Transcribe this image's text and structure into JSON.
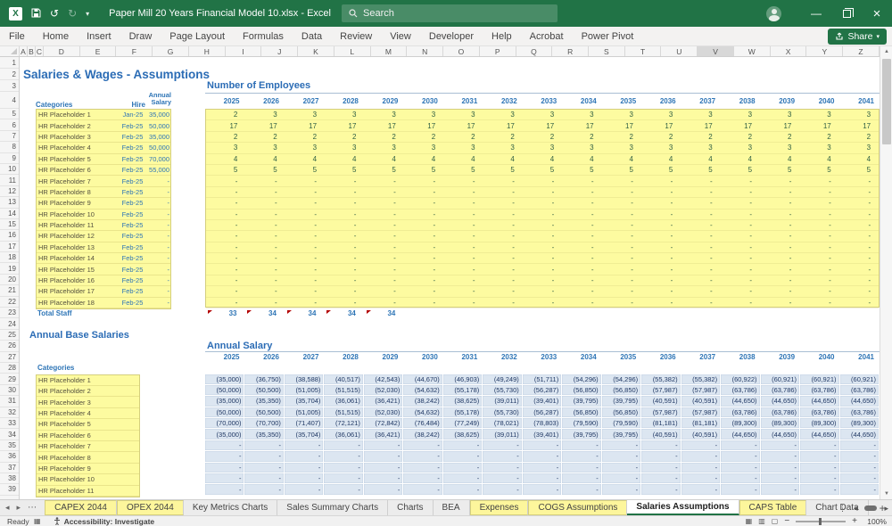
{
  "titlebar": {
    "title": "Paper Mill 20 Years Financial Model 10.xlsx  -  Excel",
    "search_placeholder": "Search"
  },
  "ribbon": {
    "tabs": [
      "File",
      "Home",
      "Insert",
      "Draw",
      "Page Layout",
      "Formulas",
      "Data",
      "Review",
      "View",
      "Developer",
      "Help",
      "Acrobat",
      "Power Pivot"
    ],
    "share_label": "Share"
  },
  "colgrid": {
    "narrow_letters": [
      "A",
      "B",
      "C"
    ],
    "wide_letters": [
      "D",
      "E",
      "F",
      "G",
      "H",
      "I",
      "J",
      "K",
      "L",
      "M",
      "N",
      "O",
      "P",
      "Q",
      "R",
      "S",
      "T",
      "U",
      "V",
      "W",
      "X",
      "Y",
      "Z"
    ],
    "selected_letter": "V",
    "first_row": 1,
    "last_row": 39
  },
  "sheet": {
    "page_title": "Salaries & Wages - Assumptions",
    "hire_table": {
      "headers": {
        "categories": "Categories",
        "hire": "Hire",
        "salary": "Annual Salary"
      },
      "rows": [
        {
          "category": "HR Placeholder 1",
          "hire": "Jan-25",
          "salary": "35,000"
        },
        {
          "category": "HR Placeholder 2",
          "hire": "Feb-25",
          "salary": "50,000"
        },
        {
          "category": "HR Placeholder 3",
          "hire": "Feb-25",
          "salary": "35,000"
        },
        {
          "category": "HR Placeholder 4",
          "hire": "Feb-25",
          "salary": "50,000"
        },
        {
          "category": "HR Placeholder 5",
          "hire": "Feb-25",
          "salary": "70,000"
        },
        {
          "category": "HR Placeholder 6",
          "hire": "Feb-25",
          "salary": "55,000"
        },
        {
          "category": "HR Placeholder 7",
          "hire": "Feb-25",
          "salary": "-"
        },
        {
          "category": "HR Placeholder 8",
          "hire": "Feb-25",
          "salary": "-"
        },
        {
          "category": "HR Placeholder 9",
          "hire": "Feb-25",
          "salary": "-"
        },
        {
          "category": "HR Placeholder 10",
          "hire": "Feb-25",
          "salary": "-"
        },
        {
          "category": "HR Placeholder 11",
          "hire": "Feb-25",
          "salary": "-"
        },
        {
          "category": "HR Placeholder 12",
          "hire": "Feb-25",
          "salary": "-"
        },
        {
          "category": "HR Placeholder 13",
          "hire": "Feb-25",
          "salary": "-"
        },
        {
          "category": "HR Placeholder 14",
          "hire": "Feb-25",
          "salary": "-"
        },
        {
          "category": "HR Placeholder 15",
          "hire": "Feb-25",
          "salary": "-"
        },
        {
          "category": "HR Placeholder 16",
          "hire": "Feb-25",
          "salary": "-"
        },
        {
          "category": "HR Placeholder 17",
          "hire": "Feb-25",
          "salary": "-"
        },
        {
          "category": "HR Placeholder 18",
          "hire": "Feb-25",
          "salary": "-"
        }
      ],
      "total_label": "Total Staff"
    },
    "employees": {
      "title": "Number of Employees",
      "years": [
        "2025",
        "2026",
        "2027",
        "2028",
        "2029",
        "2030",
        "2031",
        "2032",
        "2033",
        "2034",
        "2035",
        "2036",
        "2037",
        "2038",
        "2039",
        "2040",
        "2041"
      ],
      "rows": [
        [
          "2",
          "3",
          "3",
          "3",
          "3",
          "3",
          "3",
          "3",
          "3",
          "3",
          "3",
          "3",
          "3",
          "3",
          "3",
          "3",
          "3"
        ],
        [
          "17",
          "17",
          "17",
          "17",
          "17",
          "17",
          "17",
          "17",
          "17",
          "17",
          "17",
          "17",
          "17",
          "17",
          "17",
          "17",
          "17"
        ],
        [
          "2",
          "2",
          "2",
          "2",
          "2",
          "2",
          "2",
          "2",
          "2",
          "2",
          "2",
          "2",
          "2",
          "2",
          "2",
          "2",
          "2"
        ],
        [
          "3",
          "3",
          "3",
          "3",
          "3",
          "3",
          "3",
          "3",
          "3",
          "3",
          "3",
          "3",
          "3",
          "3",
          "3",
          "3",
          "3"
        ],
        [
          "4",
          "4",
          "4",
          "4",
          "4",
          "4",
          "4",
          "4",
          "4",
          "4",
          "4",
          "4",
          "4",
          "4",
          "4",
          "4",
          "4"
        ],
        [
          "5",
          "5",
          "5",
          "5",
          "5",
          "5",
          "5",
          "5",
          "5",
          "5",
          "5",
          "5",
          "5",
          "5",
          "5",
          "5",
          "5"
        ]
      ],
      "dash_row_count": 12,
      "totals": [
        "33",
        "34",
        "34",
        "34",
        "34"
      ]
    },
    "base_salaries": {
      "section_title": "Annual Base Salaries",
      "cat_header": "Categories",
      "categories": [
        "HR Placeholder 1",
        "HR Placeholder 2",
        "HR Placeholder 3",
        "HR Placeholder 4",
        "HR Placeholder 5",
        "HR Placeholder 6",
        "HR Placeholder 7",
        "HR Placeholder 8",
        "HR Placeholder 9",
        "HR Placeholder 10",
        "HR Placeholder 11"
      ]
    },
    "annual_salary": {
      "title": "Annual Salary",
      "years": [
        "2025",
        "2026",
        "2027",
        "2028",
        "2029",
        "2030",
        "2031",
        "2032",
        "2033",
        "2034",
        "2035",
        "2036",
        "2037",
        "2038",
        "2039",
        "2040",
        "2041"
      ],
      "rows": [
        [
          "(35,000)",
          "(36,750)",
          "(38,588)",
          "(40,517)",
          "(42,543)",
          "(44,670)",
          "(46,903)",
          "(49,249)",
          "(51,711)",
          "(54,296)",
          "(54,296)",
          "(55,382)",
          "(55,382)",
          "(60,922)",
          "(60,921)",
          "(60,921)",
          "(60,921)"
        ],
        [
          "(50,000)",
          "(50,500)",
          "(51,005)",
          "(51,515)",
          "(52,030)",
          "(54,632)",
          "(55,178)",
          "(55,730)",
          "(56,287)",
          "(56,850)",
          "(56,850)",
          "(57,987)",
          "(57,987)",
          "(63,786)",
          "(63,786)",
          "(63,786)",
          "(63,786)"
        ],
        [
          "(35,000)",
          "(35,350)",
          "(35,704)",
          "(36,061)",
          "(36,421)",
          "(38,242)",
          "(38,625)",
          "(39,011)",
          "(39,401)",
          "(39,795)",
          "(39,795)",
          "(40,591)",
          "(40,591)",
          "(44,650)",
          "(44,650)",
          "(44,650)",
          "(44,650)"
        ],
        [
          "(50,000)",
          "(50,500)",
          "(51,005)",
          "(51,515)",
          "(52,030)",
          "(54,632)",
          "(55,178)",
          "(55,730)",
          "(56,287)",
          "(56,850)",
          "(56,850)",
          "(57,987)",
          "(57,987)",
          "(63,786)",
          "(63,786)",
          "(63,786)",
          "(63,786)"
        ],
        [
          "(70,000)",
          "(70,700)",
          "(71,407)",
          "(72,121)",
          "(72,842)",
          "(76,484)",
          "(77,249)",
          "(78,021)",
          "(78,803)",
          "(79,590)",
          "(79,590)",
          "(81,181)",
          "(81,181)",
          "(89,300)",
          "(89,300)",
          "(89,300)",
          "(89,300)"
        ],
        [
          "(35,000)",
          "(35,350)",
          "(35,704)",
          "(36,061)",
          "(36,421)",
          "(38,242)",
          "(38,625)",
          "(39,011)",
          "(39,401)",
          "(39,795)",
          "(39,795)",
          "(40,591)",
          "(40,591)",
          "(44,650)",
          "(44,650)",
          "(44,650)",
          "(44,650)"
        ]
      ],
      "dash_row_count": 5
    }
  },
  "sheet_tabs": {
    "tabs": [
      {
        "label": "CAPEX 2044",
        "style": "yellow"
      },
      {
        "label": "OPEX 2044",
        "style": "yellow"
      },
      {
        "label": "Key Metrics Charts",
        "style": "normal"
      },
      {
        "label": "Sales Summary Charts",
        "style": "normal"
      },
      {
        "label": "Charts",
        "style": "normal"
      },
      {
        "label": "BEA",
        "style": "normal"
      },
      {
        "label": "Expenses",
        "style": "yellow"
      },
      {
        "label": "COGS Assumptions",
        "style": "yellow"
      },
      {
        "label": "Salaries Assumptions",
        "style": "active"
      },
      {
        "label": "CAPS Table",
        "style": "yellow"
      },
      {
        "label": "Chart Data",
        "style": "normal"
      }
    ],
    "add_label": "+"
  },
  "statusbar": {
    "ready": "Ready",
    "accessibility": "Accessibility: Investigate",
    "zoom": "100%"
  },
  "colors": {
    "titlebar_green": "#217346",
    "heading_blue": "#2b6cb5",
    "header_text_blue": "#2e75b6",
    "input_yellow": "#fdfba0",
    "calc_cell_blue": "#dce6f1",
    "value_navy": "#203864",
    "employee_green": "#2f5f44",
    "flag_red": "#b30000",
    "tab_yellow": "#fdf69c"
  }
}
